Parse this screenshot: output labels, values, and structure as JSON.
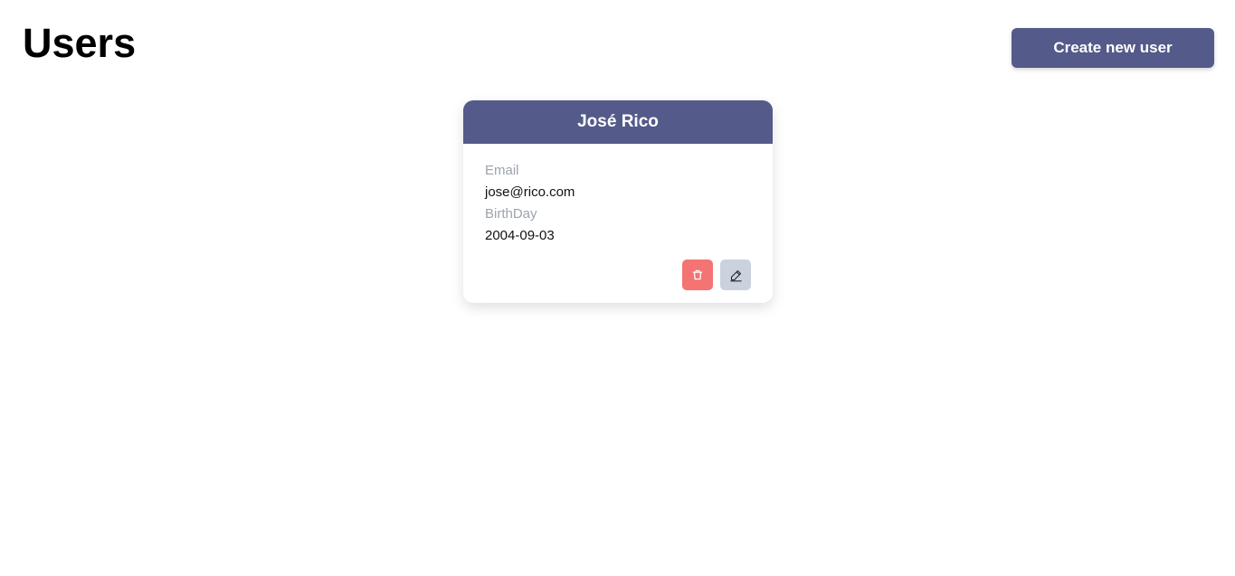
{
  "header": {
    "title": "Users",
    "create_button_label": "Create new user"
  },
  "users": [
    {
      "name": "José Rico",
      "email_label": "Email",
      "email": "jose@rico.com",
      "birthday_label": "BirthDay",
      "birthday": "2004-09-03",
      "actions": {
        "delete_icon": "trash-icon",
        "edit_icon": "pencil-icon"
      }
    }
  ],
  "colors": {
    "primary": "#545a89",
    "danger": "#f47373",
    "secondary": "#cbd2de",
    "label": "#9ca3af"
  }
}
